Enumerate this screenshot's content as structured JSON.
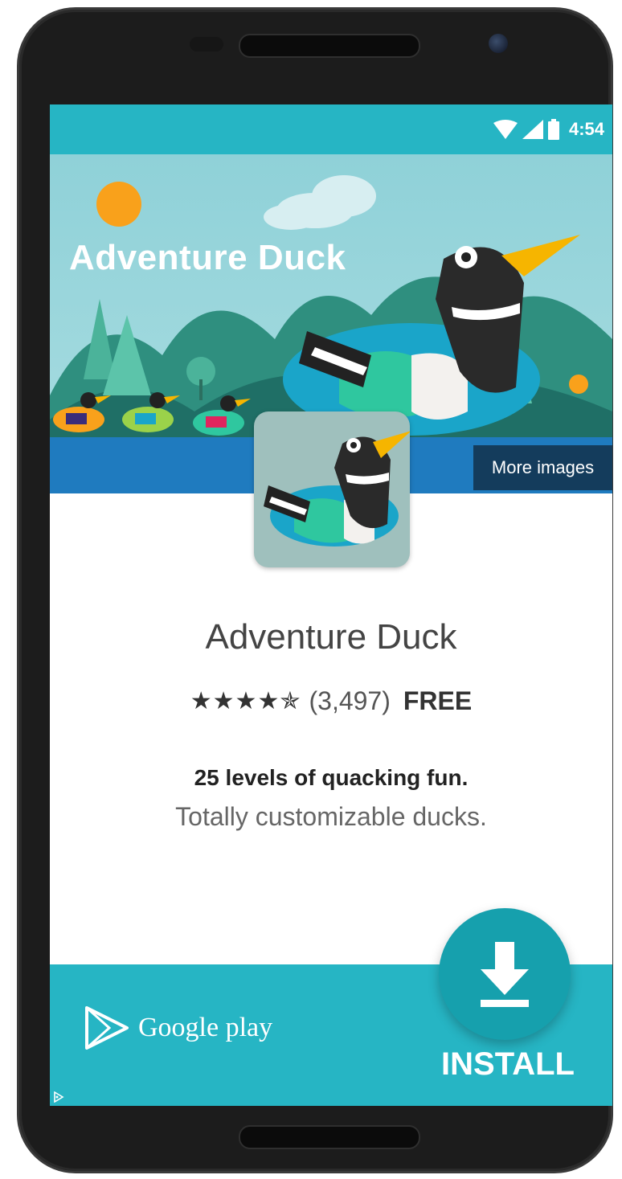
{
  "status_bar": {
    "time": "4:54",
    "icons": [
      "wifi-icon",
      "cellular-signal-icon",
      "battery-icon"
    ]
  },
  "banner": {
    "title": "Adventure Duck",
    "more_images_label": "More images"
  },
  "app": {
    "name": "Adventure Duck",
    "stars_display": "★★★★✯",
    "rating_stars": 4.5,
    "rating_count": "(3,497)",
    "price": "FREE",
    "tagline_primary": "25 levels of quacking fun.",
    "tagline_secondary": "Totally customizable ducks."
  },
  "footer": {
    "store_name": "Google play",
    "install_label": "INSTALL",
    "install_icon": "download-icon"
  },
  "colors": {
    "accent": "#26b5c4",
    "fab": "#16a0ad",
    "more_images_bg": "#143c5c",
    "duck_beak": "#f6b500"
  }
}
